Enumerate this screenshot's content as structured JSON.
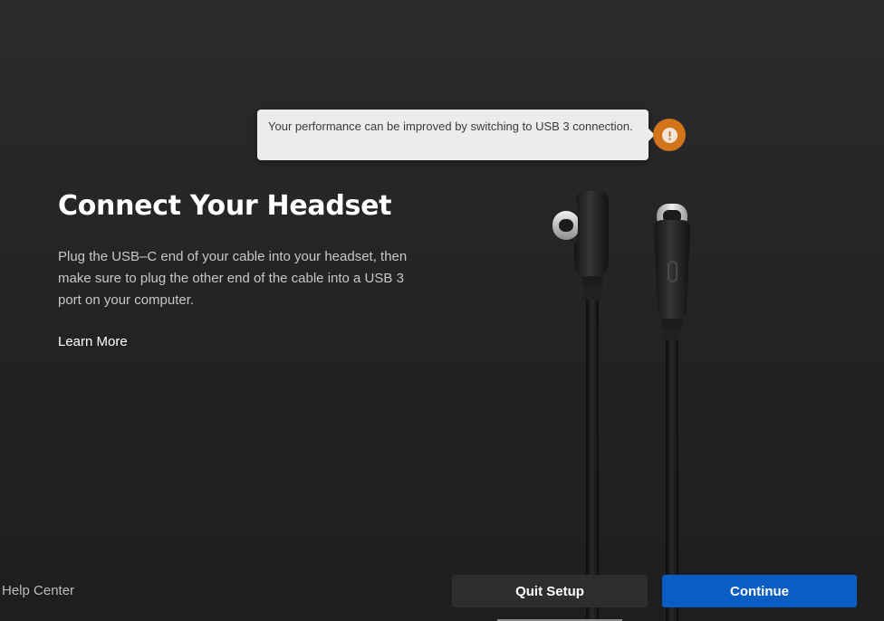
{
  "tooltip": {
    "message": "Your performance can be improved by switching to USB 3 connection.",
    "icon": "warning-icon",
    "icon_color": "#d2741a"
  },
  "main": {
    "title": "Connect Your Headset",
    "description": "Plug the USB–C end of your cable into your headset, then make sure to plug the other end of the cable into a USB 3 port on your computer.",
    "learn_more": "Learn More",
    "illustration": "usb-c-cable-illustration"
  },
  "footer": {
    "help_center": "Help Center",
    "quit_label": "Quit Setup",
    "continue_label": "Continue",
    "accent_color": "#0a5dc2"
  }
}
